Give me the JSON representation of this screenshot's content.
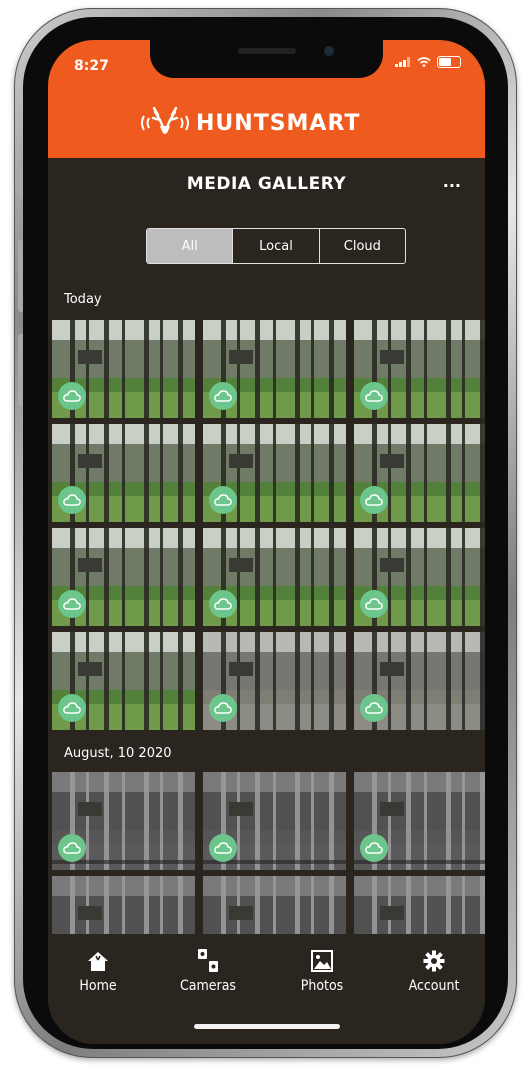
{
  "status_bar": {
    "time": "8:27"
  },
  "header": {
    "brand": "HUNTSMART",
    "title": "MEDIA GALLERY",
    "more": "..."
  },
  "filter": {
    "tabs": [
      "All",
      "Local",
      "Cloud"
    ],
    "selected": "All"
  },
  "sections": [
    {
      "label": "Today",
      "tiles": 12
    },
    {
      "label": "August, 10 2020",
      "tiles": 6
    }
  ],
  "bottom_nav": {
    "items": [
      {
        "label": "Home",
        "icon": "home-icon"
      },
      {
        "label": "Cameras",
        "icon": "cameras-icon"
      },
      {
        "label": "Photos",
        "icon": "photos-icon"
      },
      {
        "label": "Account",
        "icon": "gear-icon"
      }
    ]
  },
  "colors": {
    "accent": "#ef5a1e",
    "background": "#2b2520",
    "cloud_badge": "#6cc58a"
  }
}
